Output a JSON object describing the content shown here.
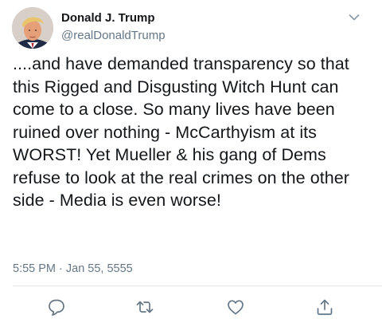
{
  "tweet": {
    "display_name": "Donald J. Trump",
    "handle": "@realDonaldTrump",
    "text": "....and have demanded transparency so that this Rigged and Disgusting Witch Hunt can come to a close. So many lives have been ruined over nothing - McCarthyism at its WORST! Yet Mueller & his gang of Dems refuse to look at the real crimes on the other side - Media is even worse!",
    "timestamp": "5:55 PM · Jan 55, 5555"
  },
  "icons": {
    "avatar": "profile-photo",
    "menu": "chevron-down-icon",
    "reply": "reply-icon",
    "retweet": "retweet-icon",
    "like": "heart-icon",
    "share": "share-icon"
  },
  "colors": {
    "text": "#14171a",
    "secondary": "#657786",
    "icon": "#657786",
    "divider": "#e1e8ed"
  }
}
